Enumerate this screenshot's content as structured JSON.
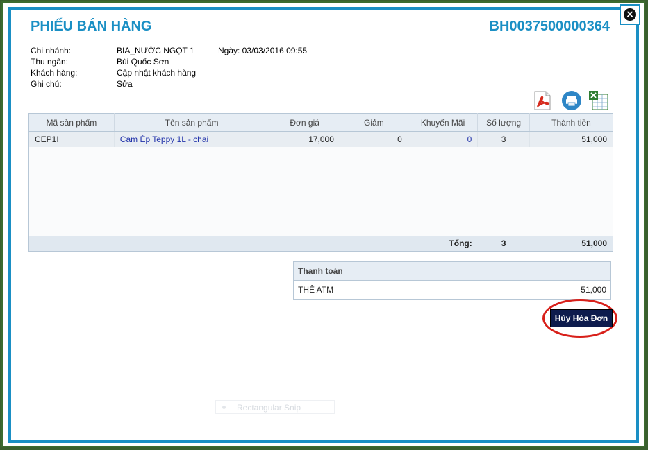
{
  "dialog": {
    "title": "PHIẾU BÁN HÀNG",
    "code": "BH0037500000364",
    "close_icon": "close-circle-icon"
  },
  "info": {
    "branch_label": "Chi nhánh:",
    "branch_value": "BIA_NƯỚC NGỌT 1",
    "date_text": "Ngày: 03/03/2016 09:55",
    "cashier_label": "Thu ngân:",
    "cashier_value": "Bùi Quốc Sơn",
    "customer_label": "Khách hàng:",
    "customer_value": "Cập nhật khách hàng",
    "note_label": "Ghi chú:",
    "note_value": "Sửa"
  },
  "toolbar": {
    "icons": [
      "pdf-icon",
      "print-icon",
      "excel-icon"
    ]
  },
  "table": {
    "columns": [
      "Mã sản phẩm",
      "Tên sản phẩm",
      "Đơn giá",
      "Giảm",
      "Khuyến Mãi",
      "Số lượng",
      "Thành tiền"
    ],
    "rows": [
      {
        "code": "CEP1I",
        "name": "Cam Ép Teppy 1L - chai",
        "price": "17,000",
        "discount": "0",
        "promo": "0",
        "qty": "3",
        "total": "51,000"
      }
    ],
    "total_label": "Tổng:",
    "total_qty": "3",
    "total_amount": "51,000"
  },
  "payment": {
    "header": "Thanh toán",
    "method": "THẺ ATM",
    "amount": "51,000"
  },
  "actions": {
    "cancel_label": "Hủy Hóa Đơn"
  },
  "colors": {
    "accent": "#1a8fc4",
    "cancel_bg": "#0d1b4d",
    "highlight_ring": "#d8201a"
  },
  "ghost_snip": {
    "label": "Rectangular Snip"
  }
}
